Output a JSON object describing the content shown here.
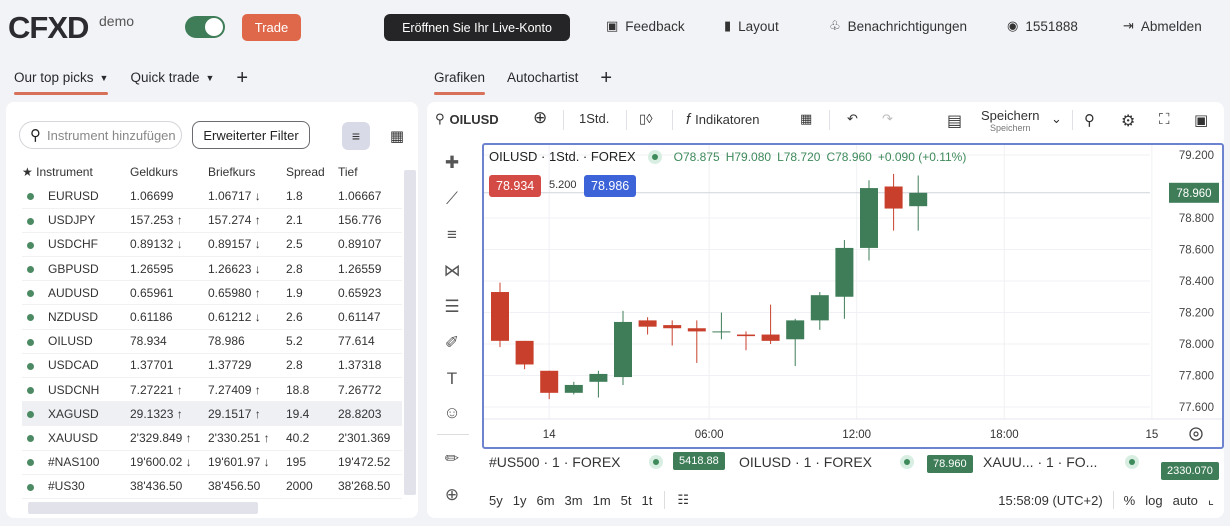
{
  "header": {
    "logo": "CFXD",
    "logo_badge": "demo",
    "toggle_on": true,
    "trade_label": "Trade",
    "live_account_label": "Eröffnen Sie Ihr Live-Konto",
    "nav": [
      {
        "icon": "feedback-icon",
        "label": "Feedback"
      },
      {
        "icon": "layout-icon",
        "label": "Layout"
      },
      {
        "icon": "bell-icon",
        "label": "Benachrichtigungen"
      },
      {
        "icon": "account-icon",
        "label": "1551888"
      },
      {
        "icon": "logout-icon",
        "label": "Abmelden"
      }
    ]
  },
  "left_tabs": [
    {
      "label": "Our top picks",
      "active": true,
      "dropdown": true
    },
    {
      "label": "Quick trade",
      "active": false,
      "dropdown": true
    }
  ],
  "right_tabs": [
    {
      "label": "Grafiken",
      "active": true
    },
    {
      "label": "Autochartist",
      "active": false
    }
  ],
  "watchlist": {
    "search_placeholder": "Instrument hinzufügen",
    "filter_label": "Erweiterter Filter",
    "columns": [
      "Instrument",
      "Geldkurs",
      "Briefkurs",
      "Spread",
      "Tief"
    ],
    "rows": [
      {
        "instrument": "EURUSD",
        "bid": "1.06699",
        "bid_dir": "",
        "ask": "1.06717",
        "ask_dir": "down",
        "spread": "1.8",
        "low": "1.06667"
      },
      {
        "instrument": "USDJPY",
        "bid": "157.253",
        "bid_dir": "up",
        "ask": "157.274",
        "ask_dir": "up",
        "spread": "2.1",
        "low": "156.776"
      },
      {
        "instrument": "USDCHF",
        "bid": "0.89132",
        "bid_dir": "down",
        "ask": "0.89157",
        "ask_dir": "down",
        "spread": "2.5",
        "low": "0.89107"
      },
      {
        "instrument": "GBPUSD",
        "bid": "1.26595",
        "bid_dir": "",
        "ask": "1.26623",
        "ask_dir": "down",
        "spread": "2.8",
        "low": "1.26559"
      },
      {
        "instrument": "AUDUSD",
        "bid": "0.65961",
        "bid_dir": "",
        "ask": "0.65980",
        "ask_dir": "up",
        "spread": "1.9",
        "low": "0.65923"
      },
      {
        "instrument": "NZDUSD",
        "bid": "0.61186",
        "bid_dir": "",
        "ask": "0.61212",
        "ask_dir": "down",
        "spread": "2.6",
        "low": "0.61147"
      },
      {
        "instrument": "OILUSD",
        "bid": "78.934",
        "bid_dir": "",
        "ask": "78.986",
        "ask_dir": "",
        "spread": "5.2",
        "low": "77.614"
      },
      {
        "instrument": "USDCAD",
        "bid": "1.37701",
        "bid_dir": "",
        "ask": "1.37729",
        "ask_dir": "",
        "spread": "2.8",
        "low": "1.37318"
      },
      {
        "instrument": "USDCNH",
        "bid": "7.27221",
        "bid_dir": "up",
        "ask": "7.27409",
        "ask_dir": "up",
        "spread": "18.8",
        "low": "7.26772"
      },
      {
        "instrument": "XAGUSD",
        "bid": "29.1323",
        "bid_dir": "up",
        "ask": "29.1517",
        "ask_dir": "up",
        "spread": "19.4",
        "low": "28.8203",
        "highlighted": true
      },
      {
        "instrument": "XAUUSD",
        "bid": "2'329.849",
        "bid_dir": "up",
        "ask": "2'330.251",
        "ask_dir": "up",
        "spread": "40.2",
        "low": "2'301.369"
      },
      {
        "instrument": "#NAS100",
        "bid": "19'600.02",
        "bid_dir": "down",
        "ask": "19'601.97",
        "ask_dir": "down",
        "spread": "195",
        "low": "19'472.52"
      },
      {
        "instrument": "#US30",
        "bid": "38'436.50",
        "bid_dir": "",
        "ask": "38'456.50",
        "ask_dir": "",
        "spread": "2000",
        "low": "38'268.50"
      }
    ]
  },
  "chart_toolbar": {
    "symbol": "OILUSD",
    "interval": "1Std.",
    "indicators_label": "Indikatoren",
    "save_label": "Speichern",
    "save_sublabel": "Speichern"
  },
  "chart_legend": {
    "title": "OILUSD · 1Std. · FOREX",
    "open": "O78.875",
    "high": "H79.080",
    "low": "L78.720",
    "close": "C78.960",
    "change": "+0.090 (+0.11%)",
    "bid": "78.934",
    "spread": "5.200",
    "ask": "78.986"
  },
  "compare_bar": [
    {
      "label": "#US500 · 1 · FOREX",
      "price": "5418.88"
    },
    {
      "label": "OILUSD · 1 · FOREX",
      "price": "78.960"
    },
    {
      "label": "XAUU... · 1 · FO...",
      "price": "2330.070"
    }
  ],
  "bottom_bar": {
    "ranges": [
      "5y",
      "1y",
      "6m",
      "3m",
      "1m",
      "5t",
      "1t"
    ],
    "time": "15:58:09 (UTC+2)",
    "percent_label": "%",
    "log_label": "log",
    "auto_label": "auto"
  },
  "colors": {
    "accent": "#e0684a",
    "up": "#3f7d58",
    "down": "#c8402c",
    "bid": "#d44b45",
    "ask": "#3c63d8",
    "frame": "#6d83cf"
  },
  "chart_data": {
    "type": "candlestick",
    "title": "OILUSD · 1Std. · FOREX",
    "ylim": [
      77.5,
      79.3
    ],
    "yticks": [
      "79.200",
      "78.800",
      "78.600",
      "78.400",
      "78.200",
      "78.000",
      "77.800",
      "77.600"
    ],
    "ytick_values": [
      79.2,
      78.8,
      78.6,
      78.4,
      78.2,
      78.0,
      77.8,
      77.6
    ],
    "xticks": [
      "14",
      "06:00",
      "12:00",
      "18:00",
      "15"
    ],
    "xtick_index": [
      2,
      8.5,
      14.5,
      20.5,
      26.5
    ],
    "last_price": "78.960",
    "last_price_value": 78.96,
    "candles": [
      {
        "o": 78.33,
        "h": 78.39,
        "l": 77.98,
        "c": 78.02
      },
      {
        "o": 78.02,
        "h": 78.02,
        "l": 77.84,
        "c": 77.87
      },
      {
        "o": 77.83,
        "h": 77.83,
        "l": 77.65,
        "c": 77.69
      },
      {
        "o": 77.69,
        "h": 77.76,
        "l": 77.68,
        "c": 77.74
      },
      {
        "o": 77.76,
        "h": 77.83,
        "l": 77.66,
        "c": 77.81
      },
      {
        "o": 77.79,
        "h": 78.21,
        "l": 77.74,
        "c": 78.14
      },
      {
        "o": 78.15,
        "h": 78.17,
        "l": 78.06,
        "c": 78.11
      },
      {
        "o": 78.12,
        "h": 78.15,
        "l": 77.99,
        "c": 78.1
      },
      {
        "o": 78.1,
        "h": 78.15,
        "l": 77.88,
        "c": 78.08
      },
      {
        "o": 78.08,
        "h": 78.2,
        "l": 78.03,
        "c": 78.08
      },
      {
        "o": 78.06,
        "h": 78.08,
        "l": 77.96,
        "c": 78.05
      },
      {
        "o": 78.06,
        "h": 78.25,
        "l": 78.0,
        "c": 78.02
      },
      {
        "o": 78.03,
        "h": 78.16,
        "l": 77.86,
        "c": 78.15
      },
      {
        "o": 78.15,
        "h": 78.33,
        "l": 78.09,
        "c": 78.31
      },
      {
        "o": 78.3,
        "h": 78.66,
        "l": 78.16,
        "c": 78.61
      },
      {
        "o": 78.61,
        "h": 79.04,
        "l": 78.53,
        "c": 78.99
      },
      {
        "o": 79.0,
        "h": 79.08,
        "l": 78.72,
        "c": 78.86
      },
      {
        "o": 78.875,
        "h": 79.07,
        "l": 78.72,
        "c": 78.96
      }
    ]
  }
}
